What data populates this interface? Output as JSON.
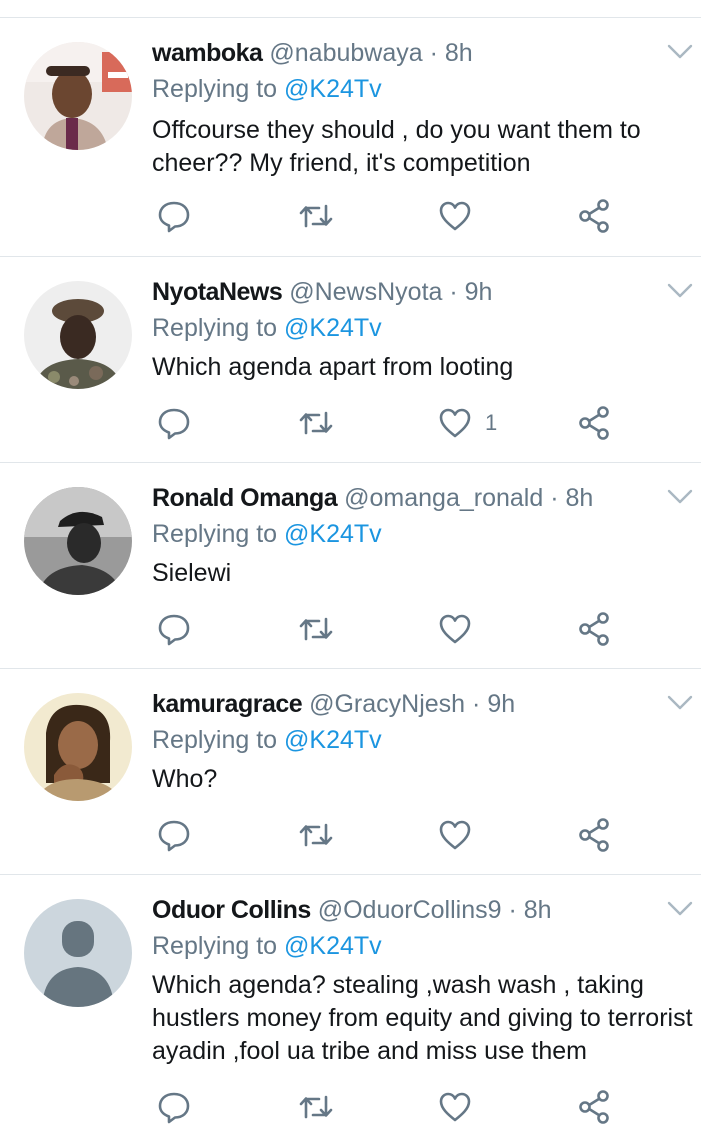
{
  "tweets": [
    {
      "name": "wamboka",
      "handle": "@nabubwaya",
      "time": "· 8h",
      "replying_prefix": "Replying to ",
      "replying_to": "@K24Tv",
      "text": "Offcourse they should , do you want them to cheer?? My friend, it's competition",
      "likes": "",
      "avatar": "photo-man-hat-tie"
    },
    {
      "name": "NyotaNews",
      "handle": "@NewsNyota",
      "time": "· 9h",
      "replying_prefix": "Replying to ",
      "replying_to": "@K24Tv",
      "text": "Which agenda apart from looting",
      "likes": "1",
      "avatar": "photo-man-beret"
    },
    {
      "name": "Ronald Omanga",
      "handle": "@omanga_ronald",
      "time": "· 8h",
      "replying_prefix": "Replying to ",
      "replying_to": "@K24Tv",
      "text": "Sielewi",
      "likes": "",
      "avatar": "photo-man-cap-bw"
    },
    {
      "name": "kamuragrace",
      "handle": "@GracyNjesh",
      "time": "· 9h",
      "replying_prefix": "Replying to ",
      "replying_to": "@K24Tv",
      "text": "Who?",
      "likes": "",
      "avatar": "photo-woman-headphones"
    },
    {
      "name": "Oduor Collins",
      "handle": "@OduorCollins9",
      "time": "· 8h",
      "replying_prefix": "Replying to ",
      "replying_to": "@K24Tv",
      "text": "Which agenda? stealing ,wash wash , taking hustlers money from equity and giving to terrorist ayadin ,fool ua tribe and miss use them",
      "likes": "",
      "avatar": "default-avatar"
    }
  ],
  "icons": {
    "reply": "reply-icon",
    "retweet": "retweet-icon",
    "like": "heart-icon",
    "share": "share-icon",
    "menu": "chevron-down-icon"
  },
  "colors": {
    "text": "#14171a",
    "muted": "#657786",
    "mention": "#1b95e0",
    "divider": "#e1e6ea",
    "icon": "#657786"
  }
}
